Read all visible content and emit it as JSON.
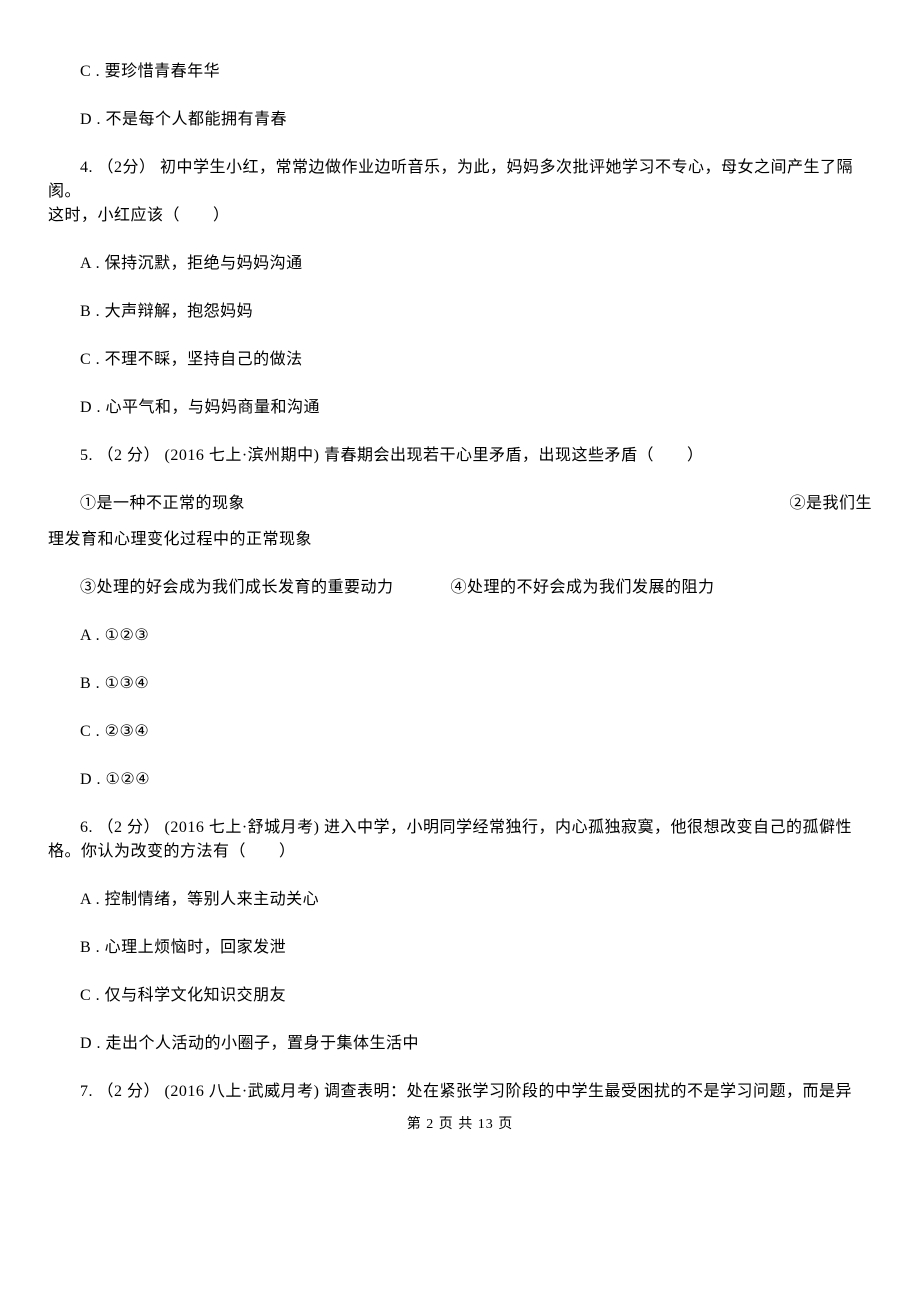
{
  "q3": {
    "options": {
      "C": "C . 要珍惜青春年华",
      "D": "D . 不是每个人都能拥有青春"
    }
  },
  "q4": {
    "stem_line1": "4. （2分） 初中学生小红，常常边做作业边听音乐，为此，妈妈多次批评她学习不专心，母女之间产生了隔阂。",
    "stem_line2": "这时，小红应该（　　）",
    "options": {
      "A": "A . 保持沉默，拒绝与妈妈沟通",
      "B": "B . 大声辩解，抱怨妈妈",
      "C": "C . 不理不睬，坚持自己的做法",
      "D": "D . 心平气和，与妈妈商量和沟通"
    }
  },
  "q5": {
    "stem": "5. （2 分） (2016 七上·滨州期中) 青春期会出现若干心里矛盾，出现这些矛盾（　　）",
    "statements": {
      "s1": "①是一种不正常的现象",
      "s2": "②是我们生",
      "s2_cont": "理发育和心理变化过程中的正常现象",
      "s3": "③处理的好会成为我们成长发育的重要动力",
      "s4": "④处理的不好会成为我们发展的阻力"
    },
    "options": {
      "A": "A . ①②③",
      "B": "B . ①③④",
      "C": "C . ②③④",
      "D": "D . ①②④"
    }
  },
  "q6": {
    "stem_line1": "6. （2 分） (2016 七上·舒城月考) 进入中学，小明同学经常独行，内心孤独寂寞，他很想改变自己的孤僻性",
    "stem_line2": "格。你认为改变的方法有（　　）",
    "options": {
      "A": "A . 控制情绪，等别人来主动关心",
      "B": "B . 心理上烦恼时，回家发泄",
      "C": "C . 仅与科学文化知识交朋友",
      "D": "D . 走出个人活动的小圈子，置身于集体生活中"
    }
  },
  "q7": {
    "stem_line1": "7. （2 分） (2016 八上·武威月考) 调查表明：处在紧张学习阶段的中学生最受困扰的不是学习问题，而是异"
  },
  "footer": {
    "text": "第 2 页 共 13 页"
  }
}
